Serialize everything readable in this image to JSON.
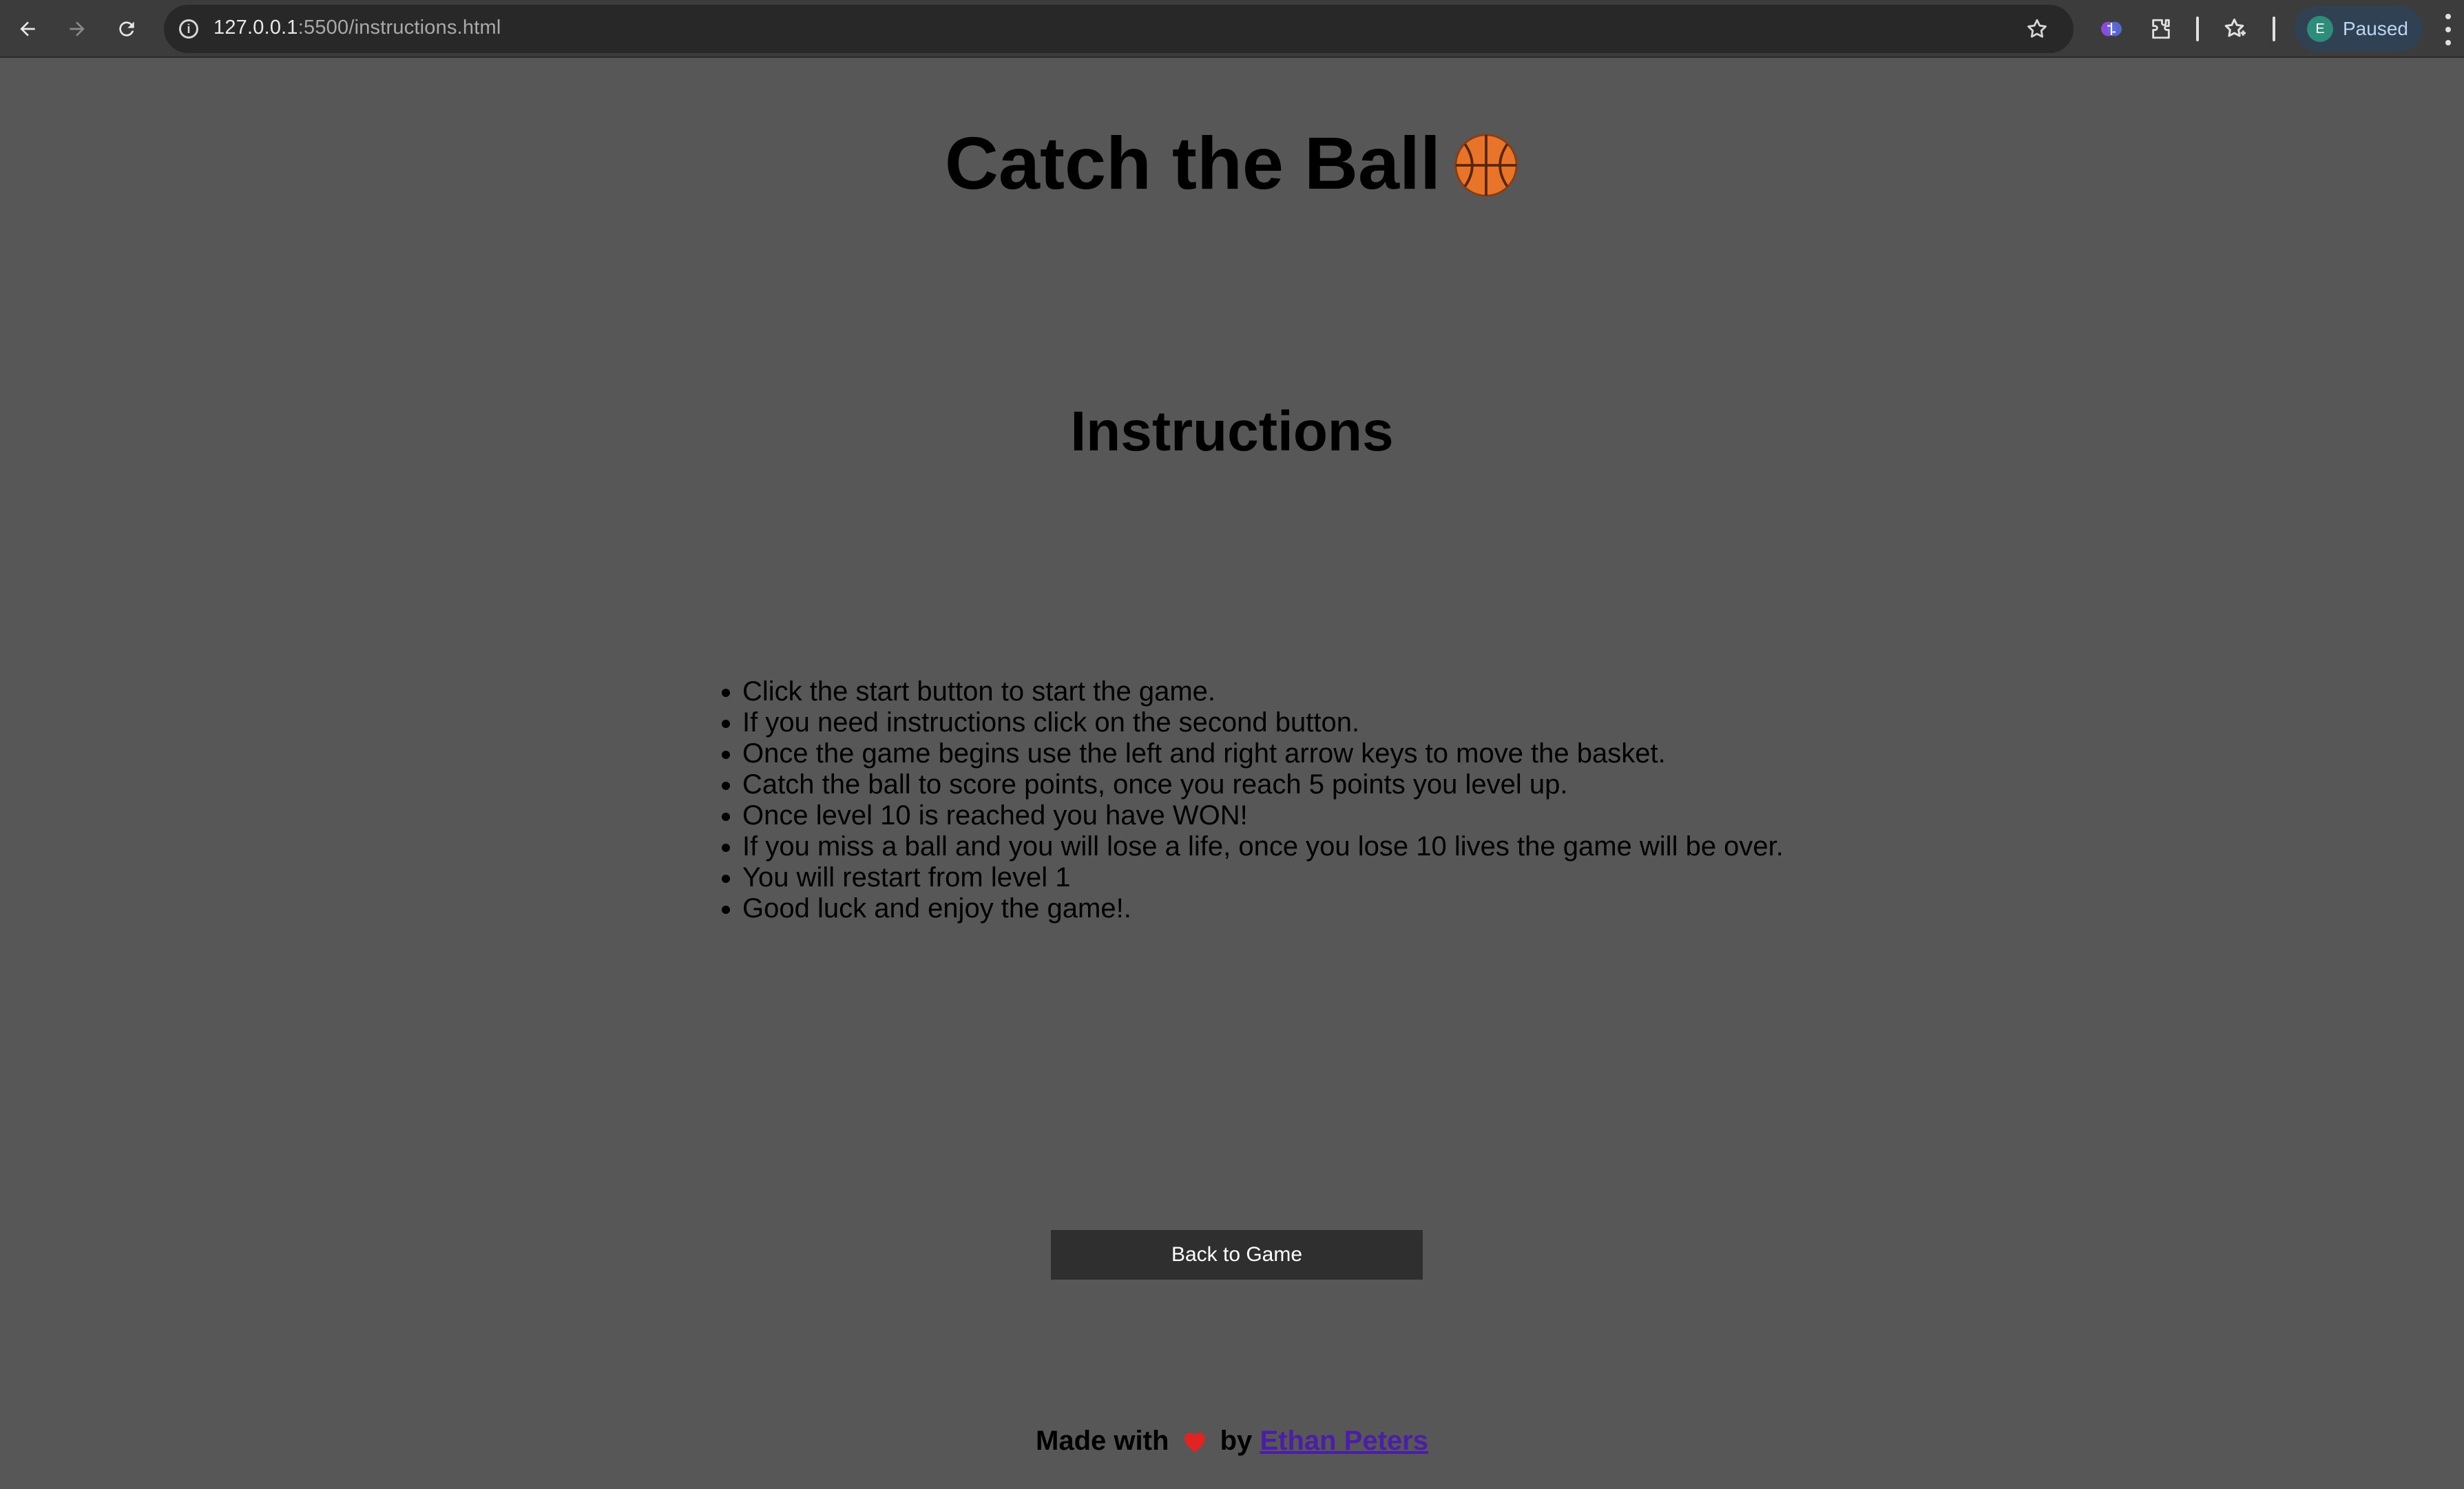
{
  "browser": {
    "url_host": "127.0.0.1",
    "url_rest": ":5500/instructions.html",
    "profile_initial": "E",
    "profile_status": "Paused"
  },
  "page": {
    "title": "Catch the Ball",
    "heading": "Instructions",
    "rules": [
      "Click the start button to start the game.",
      "If you need instructions click on the second button.",
      "Once the game begins use the left and right arrow keys to move the basket.",
      "Catch the ball to score points, once you reach 5 points you level up.",
      "Once level 10 is reached you have WON!",
      "If you miss a ball and you will lose a life, once you lose 10 lives the game will be over.",
      "You will restart from level 1",
      "Good luck and enjoy the game!."
    ],
    "back_button_label": "Back to Game",
    "footer": {
      "made_with": "Made with",
      "by": "by",
      "author": "Ethan Peters"
    }
  },
  "colors": {
    "page_background": "#575757",
    "button_background": "#2f2f2f",
    "link": "#4a1fa6"
  }
}
